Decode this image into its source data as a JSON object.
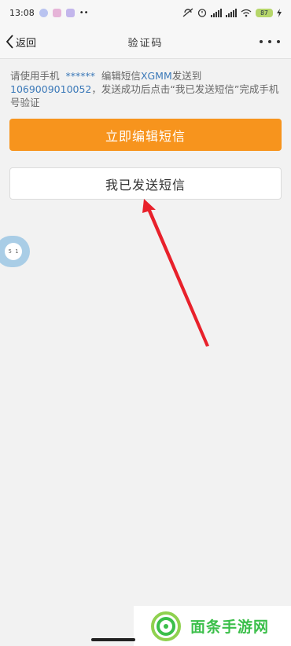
{
  "status_bar": {
    "time": "13:08",
    "battery": "87",
    "left_icons": [
      "app-icon-1",
      "app-icon-2",
      "app-icon-3"
    ],
    "right_icons": [
      "no-disturb-icon",
      "alarm-icon",
      "signal-icon",
      "signal-icon",
      "wifi-icon",
      "battery-icon",
      "charging-icon"
    ],
    "more_notifications": "••"
  },
  "nav": {
    "back_label": "返回",
    "title": "验证码",
    "more_icon": "more-horizontal-icon"
  },
  "instruction": {
    "part1": "请使用手机",
    "phone_masked": "  ******  ",
    "part2": "编辑短信",
    "keyword": "XGMM",
    "part3": "发送到",
    "number": "1069009010052",
    "part4": "，发送成功后点击“我已发送短信”完成手机号验证"
  },
  "buttons": {
    "edit_sms": "立即编辑短信",
    "sent_sms": "我已发送短信"
  },
  "float_bubble": {
    "label": "5 1"
  },
  "watermark": {
    "text": "面条手游网"
  },
  "colors": {
    "accent_orange": "#f7941d",
    "link_blue": "#3a78b8",
    "annotation_red": "#e8212b",
    "watermark_green": "#3bbf4a"
  }
}
